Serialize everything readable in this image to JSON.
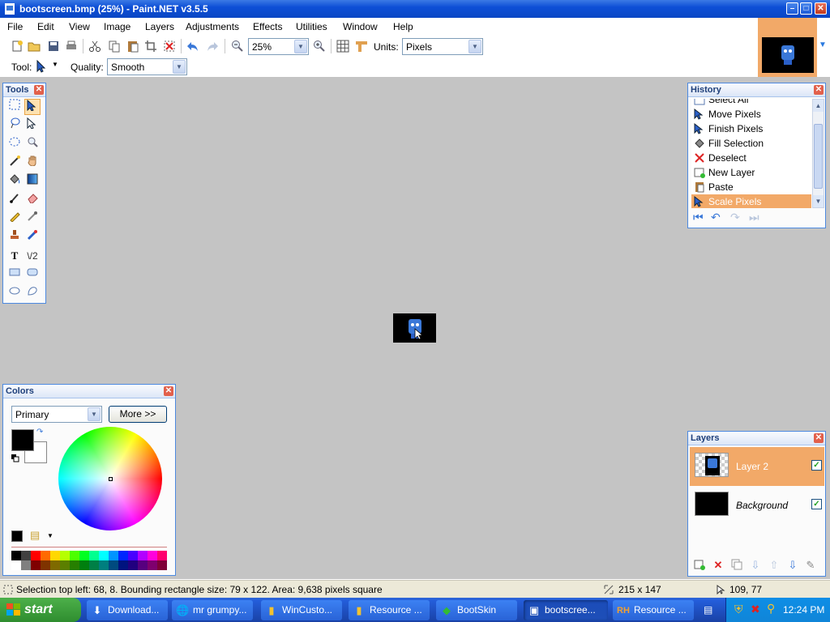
{
  "window": {
    "title": "bootscreen.bmp (25%) - Paint.NET v3.5.5"
  },
  "menu": {
    "items": [
      "File",
      "Edit",
      "View",
      "Image",
      "Layers",
      "Adjustments",
      "Effects",
      "Utilities",
      "Window",
      "Help"
    ]
  },
  "toolbar": {
    "zoom_value": "25%",
    "units_label": "Units:",
    "units_value": "Pixels",
    "tool_label": "Tool:",
    "quality_label": "Quality:",
    "quality_value": "Smooth"
  },
  "panels": {
    "tools": {
      "title": "Tools"
    },
    "history": {
      "title": "History",
      "items": [
        {
          "label": "Select All",
          "icon": "select-all-icon"
        },
        {
          "label": "Move Pixels",
          "icon": "move-pixels-icon"
        },
        {
          "label": "Finish Pixels",
          "icon": "finish-pixels-icon"
        },
        {
          "label": "Fill Selection",
          "icon": "fill-selection-icon"
        },
        {
          "label": "Deselect",
          "icon": "deselect-icon"
        },
        {
          "label": "New Layer",
          "icon": "new-layer-icon"
        },
        {
          "label": "Paste",
          "icon": "paste-icon"
        },
        {
          "label": "Scale Pixels",
          "icon": "scale-pixels-icon"
        }
      ],
      "current": "Scale Pixels"
    },
    "colors": {
      "title": "Colors",
      "mode_value": "Primary",
      "more_label": "More >>",
      "primary_color": "#000000",
      "secondary_color": "#ffffff",
      "palette": [
        "#000000",
        "#404040",
        "#ff0000",
        "#ff6a00",
        "#ffd800",
        "#b6ff00",
        "#4cff00",
        "#00ff21",
        "#00ff90",
        "#00ffff",
        "#0094ff",
        "#0026ff",
        "#4800ff",
        "#b200ff",
        "#ff00dc",
        "#ff006e",
        "#ffffff",
        "#808080",
        "#7f0000",
        "#7f3300",
        "#7f6a00",
        "#5b7f00",
        "#267f00",
        "#007f0e",
        "#007f46",
        "#007f7f",
        "#004a7f",
        "#00137f",
        "#21007f",
        "#57007f",
        "#7f006e",
        "#7f0037"
      ]
    },
    "layers": {
      "title": "Layers",
      "items": [
        {
          "name": "Layer 2",
          "visible": true,
          "selected": true
        },
        {
          "name": "Background",
          "visible": true,
          "selected": false
        }
      ]
    }
  },
  "status": {
    "selection_info": "Selection top left: 68, 8. Bounding rectangle size: 79 x 122. Area: 9,638 pixels square",
    "image_size": "215 x 147",
    "cursor_pos": "109, 77"
  },
  "taskbar": {
    "start_label": "start",
    "tasks": [
      {
        "label": "Download...",
        "icon": "download-icon"
      },
      {
        "label": "mr grumpy...",
        "icon": "browser-icon"
      },
      {
        "label": "WinCusto...",
        "icon": "folder-icon"
      },
      {
        "label": "Resource ...",
        "icon": "folder-icon"
      },
      {
        "label": "BootSkin",
        "icon": "bootskin-icon"
      },
      {
        "label": "bootscree...",
        "icon": "paintnet-icon",
        "active": true
      },
      {
        "label": "Resource ...",
        "icon": "resource-hacker-icon"
      }
    ],
    "clock": "12:24 PM"
  },
  "colors": {
    "accent": "#f2a968",
    "titlebar": "#0d4fd6",
    "workspace": "#c4c4c4"
  }
}
